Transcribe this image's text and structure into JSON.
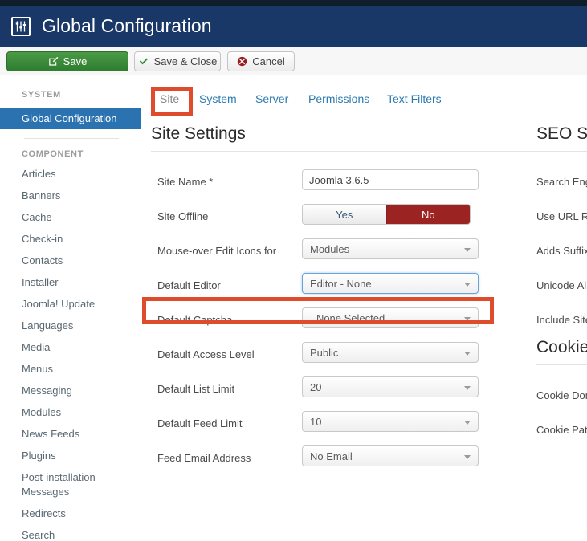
{
  "header": {
    "title": "Global Configuration",
    "icon": "sliders-icon"
  },
  "toolbar": {
    "save_label": "Save",
    "save_icon": "pencil-square-icon",
    "save_close_label": "Save & Close",
    "save_close_icon": "check-icon",
    "cancel_label": "Cancel",
    "cancel_icon": "cancel-circle-icon"
  },
  "sidebar": {
    "groups": [
      {
        "title": "SYSTEM",
        "items": [
          {
            "label": "Global Configuration",
            "active": true
          }
        ]
      },
      {
        "title": "COMPONENT",
        "items": [
          {
            "label": "Articles",
            "active": false
          },
          {
            "label": "Banners",
            "active": false
          },
          {
            "label": "Cache",
            "active": false
          },
          {
            "label": "Check-in",
            "active": false
          },
          {
            "label": "Contacts",
            "active": false
          },
          {
            "label": "Installer",
            "active": false
          },
          {
            "label": "Joomla! Update",
            "active": false
          },
          {
            "label": "Languages",
            "active": false
          },
          {
            "label": "Media",
            "active": false
          },
          {
            "label": "Menus",
            "active": false
          },
          {
            "label": "Messaging",
            "active": false
          },
          {
            "label": "Modules",
            "active": false
          },
          {
            "label": "News Feeds",
            "active": false
          },
          {
            "label": "Plugins",
            "active": false
          },
          {
            "label": "Post-installation",
            "active": false
          },
          {
            "label": "Messages",
            "active": false
          },
          {
            "label": "Redirects",
            "active": false
          },
          {
            "label": "Search",
            "active": false
          }
        ]
      }
    ]
  },
  "tabs": [
    {
      "label": "Site",
      "active": true
    },
    {
      "label": "System",
      "active": false
    },
    {
      "label": "Server",
      "active": false
    },
    {
      "label": "Permissions",
      "active": false
    },
    {
      "label": "Text Filters",
      "active": false
    }
  ],
  "site_settings": {
    "title": "Site Settings",
    "fields": [
      {
        "label": "Site Name *",
        "type": "text",
        "value": "Joomla 3.6.5"
      },
      {
        "label": "Site Offline",
        "type": "yesno",
        "yes_label": "Yes",
        "no_label": "No",
        "value": "No"
      },
      {
        "label": "Mouse-over Edit Icons for",
        "type": "select",
        "value": "Modules"
      },
      {
        "label": "Default Editor",
        "type": "select",
        "value": "Editor - None",
        "focused": true,
        "highlighted": true
      },
      {
        "label": "Default Captcha",
        "type": "select",
        "value": "- None Selected -"
      },
      {
        "label": "Default Access Level",
        "type": "select",
        "value": "Public"
      },
      {
        "label": "Default List Limit",
        "type": "select",
        "value": "20"
      },
      {
        "label": "Default Feed Limit",
        "type": "select",
        "value": "10"
      },
      {
        "label": "Feed Email Address",
        "type": "select",
        "value": "No Email"
      }
    ]
  },
  "seo_settings": {
    "title": "SEO Settings",
    "fields": [
      {
        "label": "Search Engine Friendly URLs"
      },
      {
        "label": "Use URL Rewriting"
      },
      {
        "label": "Adds Suffix to URL"
      },
      {
        "label": "Unicode Aliases"
      },
      {
        "label": "Include Site Name in Page Titles"
      }
    ]
  },
  "cookie_settings": {
    "title": "Cookie Settings",
    "fields": [
      {
        "label": "Cookie Domain"
      },
      {
        "label": "Cookie Path"
      }
    ]
  },
  "colors": {
    "header_bg": "#1a3867",
    "topstrip_bg": "#101d2d",
    "sidebar_active": "#2b72b0",
    "save_green": "#3a8b3a",
    "highlight_red": "#de4c2c",
    "offline_no_red": "#9b2423",
    "tab_link_blue": "#2a7ab0"
  },
  "annotations": [
    {
      "name": "site-tab-highlight",
      "target": "Site"
    },
    {
      "name": "default-editor-highlight",
      "target": "Default Editor"
    }
  ]
}
